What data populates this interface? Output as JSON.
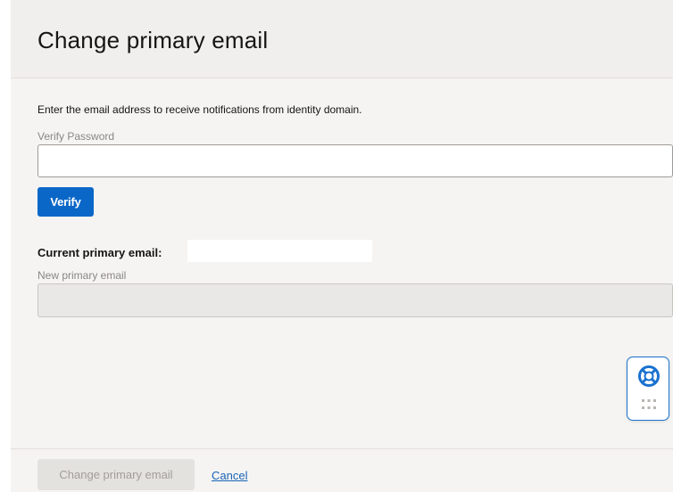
{
  "dialog": {
    "title": "Change primary email",
    "instructions": "Enter the email address to receive notifications from identity domain.",
    "verify_password": {
      "label": "Verify Password",
      "value": ""
    },
    "verify_button_label": "Verify",
    "current_email": {
      "label": "Current primary email:",
      "value": ""
    },
    "new_email": {
      "label": "New primary email",
      "value": ""
    },
    "footer": {
      "submit_label": "Change primary email",
      "cancel_label": "Cancel"
    }
  },
  "help_widget": {
    "icon": "lifebuoy-icon",
    "handle_icon": "grip-dots-icon",
    "accent_color": "#1a72d0"
  },
  "colors": {
    "primary_button": "#0b67c7",
    "disabled_button": "#e4e2df",
    "link": "#1a63b8"
  }
}
